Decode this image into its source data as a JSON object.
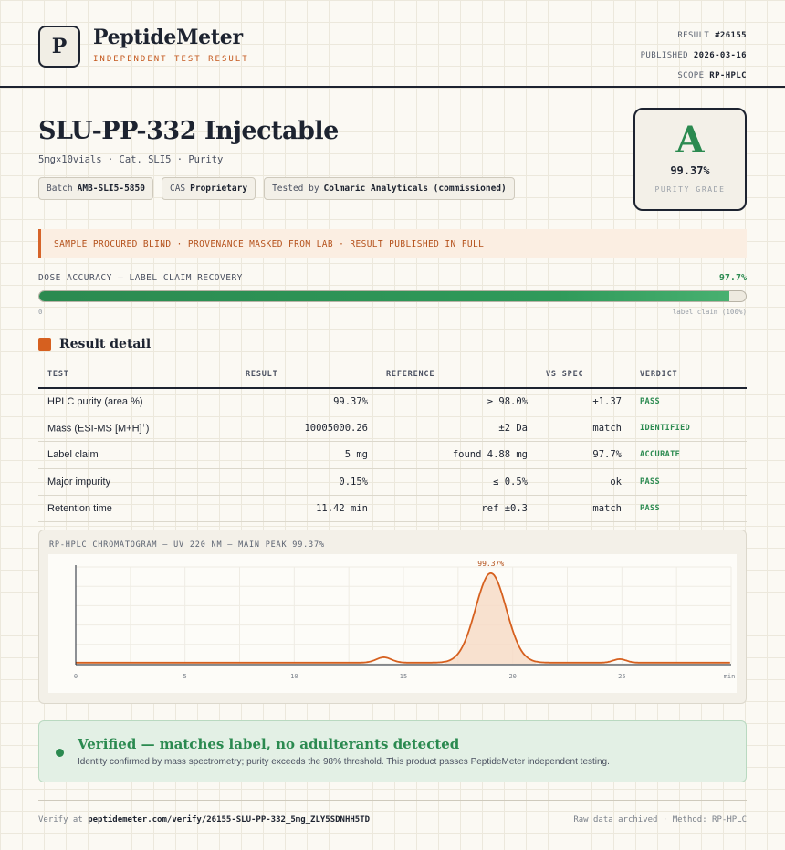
{
  "header": {
    "logo_letter": "P",
    "brand": "PeptideMeter",
    "brand_sub": "INDEPENDENT TEST RESULT",
    "result_label": "RESULT",
    "result_value": "#26155",
    "published_label": "PUBLISHED",
    "published_value": "2026-03-16",
    "scope_label": "SCOPE",
    "scope_value": "RP-HPLC"
  },
  "product": {
    "title": "SLU-PP-332 Injectable",
    "subtitle": "5mg×10vials · Cat. SLI5 · Purity",
    "chips": [
      {
        "label": "Batch",
        "value": "AMB-SLI5-5850"
      },
      {
        "label": "CAS",
        "value": "Proprietary"
      },
      {
        "label": "Tested by",
        "value": "Colmaric Analyticals (commissioned)"
      }
    ]
  },
  "grade": {
    "letter": "A",
    "percent": "99.37%",
    "label": "PURITY GRADE"
  },
  "notice": "SAMPLE PROCURED BLIND · PROVENANCE MASKED FROM LAB · RESULT PUBLISHED IN FULL",
  "dose": {
    "label": "DOSE ACCURACY — LABEL CLAIM RECOVERY",
    "value_text": "97.7%",
    "fraction": 0.977,
    "min_label": "0",
    "max_label": "label claim (100%)"
  },
  "section_title": "Result detail",
  "table": {
    "headers": [
      "TEST",
      "RESULT",
      "REFERENCE",
      "VS SPEC",
      "VERDICT"
    ],
    "rows": [
      {
        "test": "HPLC purity (area %)",
        "result": "99.37%",
        "reference": "≥ 98.0%",
        "vs_spec": "+1.37",
        "verdict": "PASS"
      },
      {
        "test": "Mass (ESI-MS [M+H]",
        "test_sup": "+",
        "test_end": ")",
        "result": "10005000.26",
        "reference": "±2 Da",
        "vs_spec": "match",
        "verdict": "IDENTIFIED"
      },
      {
        "test": "Label claim",
        "result": "5 mg",
        "reference": "found 4.88 mg",
        "vs_spec": "97.7%",
        "verdict": "ACCURATE"
      },
      {
        "test": "Major impurity",
        "result": "0.15%",
        "reference": "≤ 0.5%",
        "vs_spec": "ok",
        "verdict": "PASS"
      },
      {
        "test": "Retention time",
        "result": "11.42 min",
        "reference": "ref ±0.3",
        "vs_spec": "match",
        "verdict": "PASS"
      }
    ]
  },
  "chromatogram": {
    "title": "RP-HPLC CHROMATOGRAM — UV 220 NM — MAIN PEAK 99.37%"
  },
  "chart_data": {
    "type": "line",
    "title": "RP-HPLC CHROMATOGRAM — UV 220 NM — MAIN PEAK 99.37%",
    "xlabel": "",
    "ylabel": "",
    "xlim": [
      0,
      30
    ],
    "x_ticks": [
      "0",
      "5",
      "10",
      "15",
      "20",
      "25"
    ],
    "x_unit_label": "min",
    "peak_label": "99.37%",
    "peaks": [
      {
        "x": 14.1,
        "height": 0.06,
        "width": 0.35
      },
      {
        "x": 19.0,
        "height": 1.0,
        "width": 0.7
      },
      {
        "x": 24.9,
        "height": 0.04,
        "width": 0.3
      }
    ],
    "baseline": 0.0,
    "grid": true,
    "line_color": "#d6601f"
  },
  "verified": {
    "title": "Verified — matches label, no adulterants detected",
    "text": "Identity confirmed by mass spectrometry; purity exceeds the 98% threshold. This product passes PeptideMeter independent testing."
  },
  "footer": {
    "verify_prefix": "Verify at",
    "verify_url": "peptidemeter.com/verify/26155-SLU-PP-332_5mg_ZLY5SDNHH5TD",
    "right": "Raw data archived · Method: RP-HPLC"
  },
  "colors": {
    "accent": "#d6601f",
    "pass": "#2b8a50",
    "ink": "#1d2330"
  }
}
